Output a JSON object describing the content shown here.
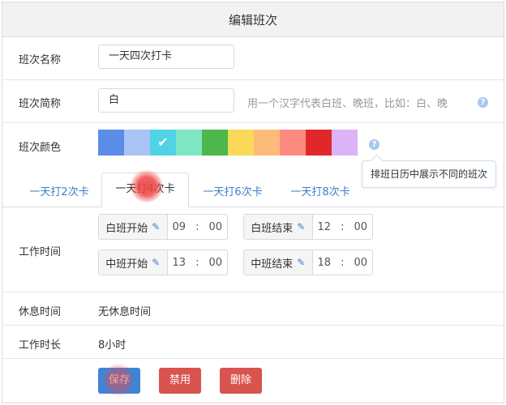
{
  "dialog": {
    "title": "编辑班次"
  },
  "fields": {
    "name": {
      "label": "班次名称",
      "value": "一天四次打卡"
    },
    "short": {
      "label": "班次简称",
      "value": "白",
      "hint": "用一个汉字代表白班、晚班，比如：白、晚"
    },
    "color": {
      "label": "班次颜色",
      "tooltip": "排班日历中展示不同的班次"
    }
  },
  "swatches": [
    {
      "color": "#5b8de8",
      "selected": false
    },
    {
      "color": "#a9c4f5",
      "selected": false
    },
    {
      "color": "#4fd3e5",
      "selected": true
    },
    {
      "color": "#7fe6c2",
      "selected": false
    },
    {
      "color": "#4cb74b",
      "selected": false
    },
    {
      "color": "#f9d85a",
      "selected": false
    },
    {
      "color": "#fdbb7a",
      "selected": false
    },
    {
      "color": "#fd8a80",
      "selected": false
    },
    {
      "color": "#e0282a",
      "selected": false
    },
    {
      "color": "#dcb3f6",
      "selected": false
    }
  ],
  "tabs": [
    {
      "label": "一天打2次卡",
      "active": false
    },
    {
      "label": "一天打4次卡",
      "active": true
    },
    {
      "label": "一天打6次卡",
      "active": false
    },
    {
      "label": "一天打8次卡",
      "active": false
    }
  ],
  "work_time": {
    "label": "工作时间",
    "slots": [
      {
        "label": "白班开始",
        "hour": "09",
        "sep": ":",
        "minute": "00"
      },
      {
        "label": "白班结束",
        "hour": "12",
        "sep": ":",
        "minute": "00"
      },
      {
        "label": "中班开始",
        "hour": "13",
        "sep": ":",
        "minute": "00"
      },
      {
        "label": "中班结束",
        "hour": "18",
        "sep": ":",
        "minute": "00"
      }
    ]
  },
  "rest_time": {
    "label": "休息时间",
    "value": "无休息时间"
  },
  "duration": {
    "label": "工作时长",
    "value": "8小时"
  },
  "buttons": {
    "save": {
      "label": "保存",
      "color": "#3d85d8"
    },
    "disable": {
      "label": "禁用",
      "color": "#d9534f"
    },
    "delete": {
      "label": "删除",
      "color": "#d9534f"
    }
  },
  "icons": {
    "help": "question-circle-icon",
    "check": "check-icon",
    "edit": "pencil-icon"
  }
}
